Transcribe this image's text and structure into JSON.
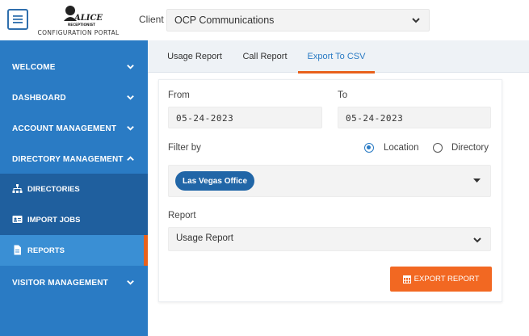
{
  "header": {
    "logo_text": "ALICE RECEPTIONIST",
    "logo_sub": "CONFIGURATION PORTAL",
    "client_label": "Client",
    "client_value": "OCP Communications"
  },
  "sidebar": {
    "items": [
      {
        "label": "WELCOME",
        "expanded": false
      },
      {
        "label": "DASHBOARD",
        "expanded": false
      },
      {
        "label": "ACCOUNT MANAGEMENT",
        "expanded": false
      },
      {
        "label": "DIRECTORY MANAGEMENT",
        "expanded": true
      },
      {
        "label": "VISITOR MANAGEMENT",
        "expanded": false
      }
    ],
    "subitems": [
      {
        "label": "DIRECTORIES",
        "icon": "sitemap-icon"
      },
      {
        "label": "IMPORT JOBS",
        "icon": "id-card-icon"
      },
      {
        "label": "REPORTS",
        "icon": "file-icon",
        "active": true
      }
    ]
  },
  "tabs": [
    {
      "label": "Usage Report"
    },
    {
      "label": "Call Report"
    },
    {
      "label": "Export To CSV",
      "active": true
    }
  ],
  "form": {
    "from_label": "From",
    "from_value": "05-24-2023",
    "to_label": "To",
    "to_value": "05-24-2023",
    "filter_label": "Filter by",
    "filter_options": [
      {
        "label": "Location",
        "selected": true
      },
      {
        "label": "Directory",
        "selected": false
      }
    ],
    "selected_chip": "Las Vegas Office",
    "report_label": "Report",
    "report_value": "Usage Report",
    "export_label": "EXPORT REPORT"
  },
  "colors": {
    "primary": "#2a7bc4",
    "sidebar_sub": "#1f5f9e",
    "accent": "#e8611c",
    "button": "#f26822"
  }
}
